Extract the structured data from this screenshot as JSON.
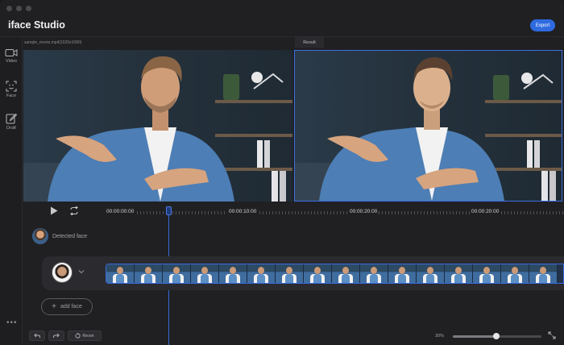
{
  "app": {
    "title": "iface Studio",
    "export_label": "Export"
  },
  "sidebar": {
    "items": [
      {
        "label": "Video",
        "icon": "video-camera-icon"
      },
      {
        "label": "Face",
        "icon": "face-scan-icon"
      },
      {
        "label": "Draft",
        "icon": "edit-icon"
      }
    ],
    "more": "•••"
  },
  "source": {
    "filename": "sample_movie.mp4(1920x1080)"
  },
  "result": {
    "tab_label": "Result"
  },
  "timeline": {
    "ticks": [
      "00:00:00:00",
      "00:00:10:00",
      "00:00:20:00",
      "00:00:20:00"
    ],
    "playhead_fraction": 0.14
  },
  "detected": {
    "label": "Detected face"
  },
  "track": {
    "frame_count": 16
  },
  "add_face": {
    "label": "add face"
  },
  "bottom": {
    "reset_label": "Reset",
    "zoom_label": "30%",
    "zoom_fraction": 0.49
  },
  "colors": {
    "accent": "#2f6be0",
    "selection": "#3b6ae0",
    "background": "#202023"
  }
}
